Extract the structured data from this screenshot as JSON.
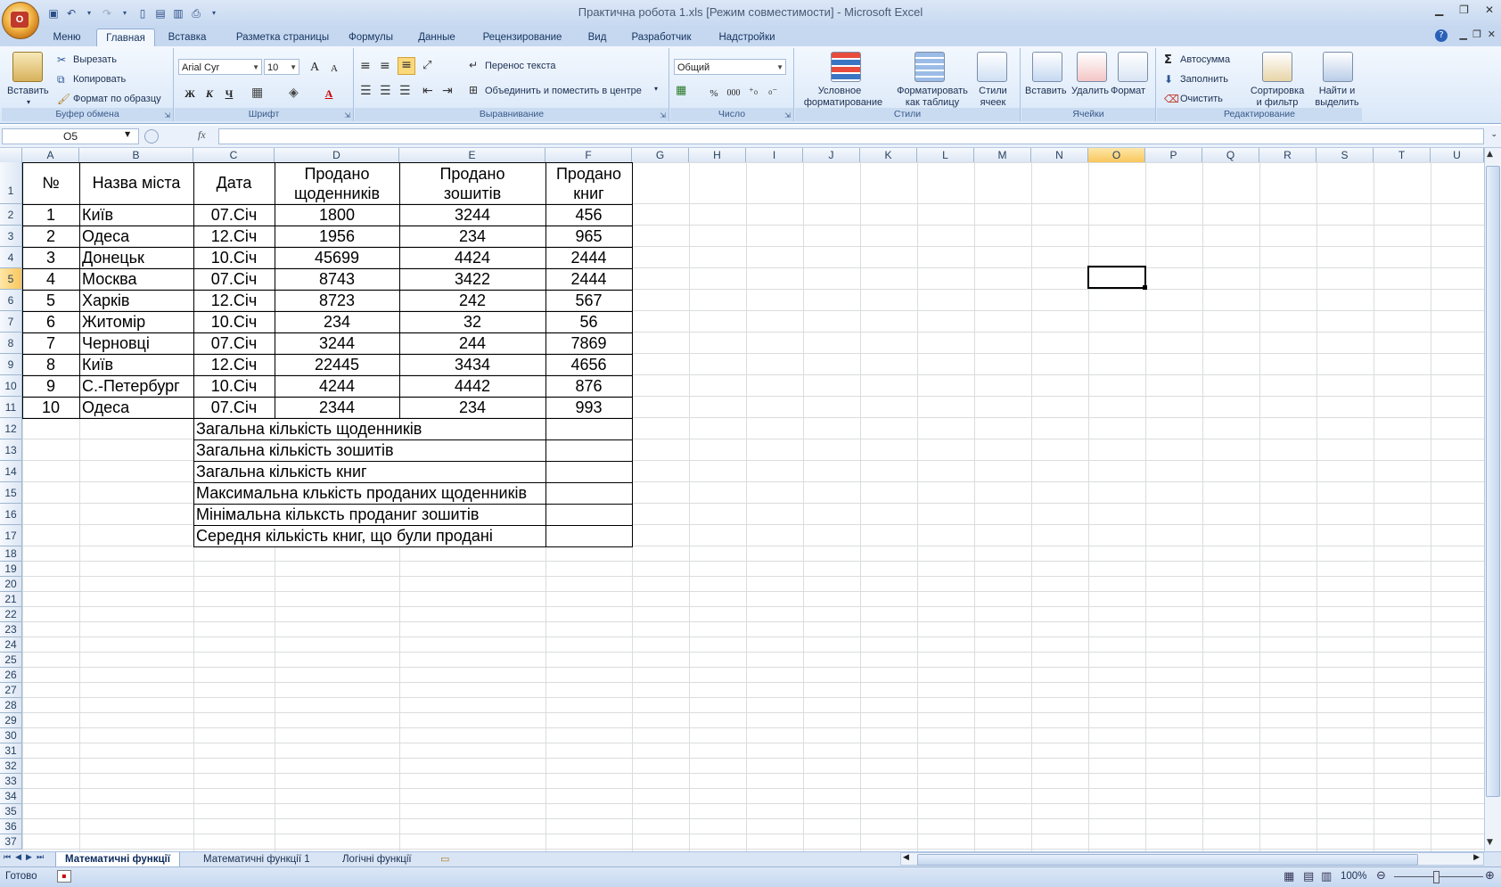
{
  "window": {
    "title": "Практична робота 1.xls  [Режим совместимости] - Microsoft Excel",
    "minimize": "▁",
    "restore": "❐",
    "close": "✕"
  },
  "tabs": [
    {
      "label": "Меню"
    },
    {
      "label": "Главная"
    },
    {
      "label": "Вставка"
    },
    {
      "label": "Разметка страницы"
    },
    {
      "label": "Формулы"
    },
    {
      "label": "Данные"
    },
    {
      "label": "Рецензирование"
    },
    {
      "label": "Вид"
    },
    {
      "label": "Разработчик"
    },
    {
      "label": "Надстройки"
    }
  ],
  "ribbon": {
    "clipboard": {
      "paste": "Вставить",
      "cut": "Вырезать",
      "copy": "Копировать",
      "format_painter": "Формат по образцу",
      "label": "Буфер обмена"
    },
    "font": {
      "name": "Arial Cyr",
      "size": "10",
      "bold": "Ж",
      "italic": "К",
      "underline": "Ч",
      "grow": "A",
      "shrink": "A",
      "font_color": "A",
      "label": "Шрифт"
    },
    "alignment": {
      "wrap": "Перенос текста",
      "merge": "Объединить и поместить в центре",
      "label": "Выравнивание"
    },
    "number": {
      "format": "Общий",
      "percent": "%",
      "thousands": "000",
      "inc_decimal": ",0→,00",
      "dec_decimal": ",00→,0",
      "label": "Число"
    },
    "styles": {
      "conditional": "Условное\nформатирование",
      "conditional_1": "Условное",
      "conditional_2": "форматирование",
      "as_table_1": "Форматировать",
      "as_table_2": "как таблицу",
      "cell_styles_1": "Стили",
      "cell_styles_2": "ячеек",
      "label": "Стили"
    },
    "cells": {
      "insert": "Вставить",
      "delete": "Удалить",
      "format": "Формат",
      "label": "Ячейки"
    },
    "editing": {
      "autosum": "Автосумма",
      "fill": "Заполнить",
      "clear": "Очистить",
      "sort_1": "Сортировка",
      "sort_2": "и фильтр",
      "find_1": "Найти и",
      "find_2": "выделить",
      "label": "Редактирование"
    }
  },
  "formula_bar": {
    "name_box": "O5",
    "fx": "fx",
    "value": ""
  },
  "columns": [
    "A",
    "B",
    "C",
    "D",
    "E",
    "F",
    "G",
    "H",
    "I",
    "J",
    "K",
    "L",
    "M",
    "N",
    "O",
    "P",
    "Q",
    "R",
    "S",
    "T",
    "U"
  ],
  "rows": [
    "1",
    "2",
    "3",
    "4",
    "5",
    "6",
    "7",
    "8",
    "9",
    "10",
    "11",
    "12",
    "13",
    "14",
    "15",
    "16",
    "17",
    "18",
    "19",
    "20",
    "21",
    "22",
    "23",
    "24",
    "25",
    "26",
    "27",
    "28",
    "29",
    "30",
    "31",
    "32",
    "33",
    "34",
    "35",
    "36",
    "37"
  ],
  "sheet": {
    "header": {
      "num": "№",
      "city": "Назва міста",
      "date": "Дата",
      "diaries_1": "Продано",
      "diaries_2": "щоденників",
      "notebooks_1": "Продано",
      "notebooks_2": "зошитів",
      "books_1": "Продано",
      "books_2": "книг"
    },
    "data": [
      [
        "1",
        "Київ",
        "07.Січ",
        "1800",
        "3244",
        "456"
      ],
      [
        "2",
        "Одеса",
        "12.Січ",
        "1956",
        "234",
        "965"
      ],
      [
        "3",
        "Донецьк",
        "10.Січ",
        "45699",
        "4424",
        "2444"
      ],
      [
        "4",
        "Москва",
        "07.Січ",
        "8743",
        "3422",
        "2444"
      ],
      [
        "5",
        "Харків",
        "12.Січ",
        "8723",
        "242",
        "567"
      ],
      [
        "6",
        "Житомір",
        "10.Січ",
        "234",
        "32",
        "56"
      ],
      [
        "7",
        "Черновці",
        "07.Січ",
        "3244",
        "244",
        "7869"
      ],
      [
        "8",
        "Київ",
        "12.Січ",
        "22445",
        "3434",
        "4656"
      ],
      [
        "9",
        "С.-Петербург",
        "10.Січ",
        "4244",
        "4442",
        "876"
      ],
      [
        "10",
        "Одеса",
        "07.Січ",
        "2344",
        "234",
        "993"
      ]
    ],
    "summary": [
      "Загальна кількість щоденників",
      "Загальна кількість зошитів",
      "Загальна кількість книг",
      "Максимальна клькість проданих щоденників",
      "Мінімальна  кільксть проданиг зошитів",
      "Середня кількість книг, що були продані"
    ]
  },
  "sheet_tabs": [
    {
      "label": "Математичні функції"
    },
    {
      "label": "Математичні функції 1"
    },
    {
      "label": "Логічні функції"
    }
  ],
  "status": {
    "ready": "Готово",
    "zoom": "100%"
  }
}
